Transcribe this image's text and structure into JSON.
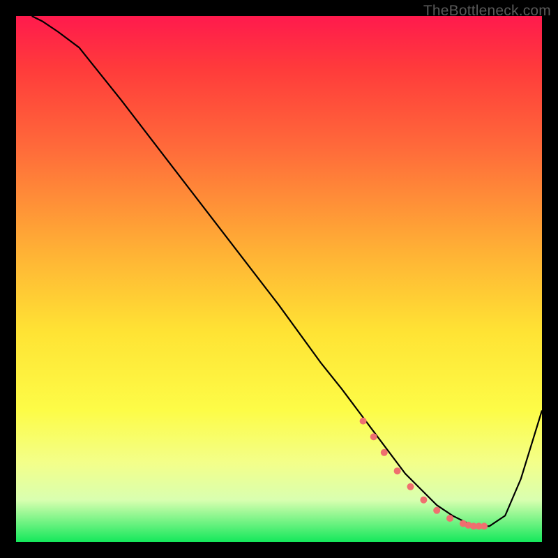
{
  "watermark": "TheBottleneck.com",
  "chart_data": {
    "type": "line",
    "title": "",
    "xlabel": "",
    "ylabel": "",
    "xlim": [
      0,
      100
    ],
    "ylim": [
      0,
      100
    ],
    "grid": false,
    "series": [
      {
        "name": "bottleneck-curve",
        "color": "#000000",
        "x": [
          3,
          5,
          8,
          12,
          20,
          30,
          40,
          50,
          58,
          62,
          65,
          68,
          71,
          74,
          77,
          80,
          83,
          86,
          88,
          90,
          93,
          96,
          100
        ],
        "y": [
          100,
          99,
          97,
          94,
          84,
          71,
          58,
          45,
          34,
          29,
          25,
          21,
          17,
          13,
          10,
          7,
          5,
          3.5,
          3,
          3,
          5,
          12,
          25
        ]
      }
    ],
    "highlight_points": {
      "color": "#ef6f6f",
      "x": [
        66,
        68,
        70,
        72.5,
        75,
        77.5,
        80,
        82.5,
        85,
        86,
        87,
        88,
        89
      ],
      "y": [
        23,
        20,
        17,
        13.5,
        10.5,
        8,
        6,
        4.5,
        3.5,
        3.2,
        3,
        3,
        3
      ]
    }
  }
}
